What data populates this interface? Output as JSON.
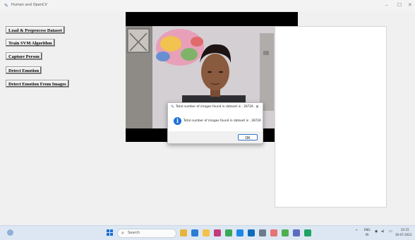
{
  "window": {
    "title": "Human and OpenCV",
    "icon": "feather-icon",
    "controls": {
      "minimize": "–",
      "maximize": "☐",
      "close": "✕"
    }
  },
  "buttons": [
    {
      "label": "Load & Preprocess Dataset"
    },
    {
      "label": "Train SVM Algorithm"
    },
    {
      "label": "Capture Person"
    },
    {
      "label": "Detect Emotion"
    },
    {
      "label": "Detect Emotion From Images"
    }
  ],
  "video": {
    "content": "webcam frame of a person",
    "background": "#000000"
  },
  "dialog": {
    "title": "Total number of images found in dataset is : 28726",
    "message": "Total number of images found in dataset is : 28726",
    "icon": "info-icon",
    "ok_label": "OK",
    "close_label": "✕"
  },
  "taskbar": {
    "search_placeholder": "Search",
    "apps": [
      {
        "icon": "file-explorer-icon",
        "color": "#e8b43a"
      },
      {
        "icon": "edge-icon",
        "color": "#2a7dd1"
      },
      {
        "icon": "folder-icon",
        "color": "#f2c14e"
      },
      {
        "icon": "store-icon",
        "color": "#c33c7a"
      },
      {
        "icon": "chrome-icon",
        "color": "#3aa757"
      },
      {
        "icon": "mail-icon",
        "color": "#1e88e5"
      },
      {
        "icon": "calendar-icon",
        "color": "#0f6cbd"
      },
      {
        "icon": "settings-icon",
        "color": "#6b7b8c"
      },
      {
        "icon": "photos-icon",
        "color": "#e57373"
      },
      {
        "icon": "browser-icon",
        "color": "#4caf50"
      },
      {
        "icon": "app-icon",
        "color": "#5c6bc0"
      },
      {
        "icon": "pycharm-icon",
        "color": "#21a366"
      }
    ],
    "tray": {
      "chevron": "^",
      "lang_top": "ENG",
      "lang_bottom": "IN",
      "time": "22:15",
      "date": "30-07-2023"
    }
  }
}
